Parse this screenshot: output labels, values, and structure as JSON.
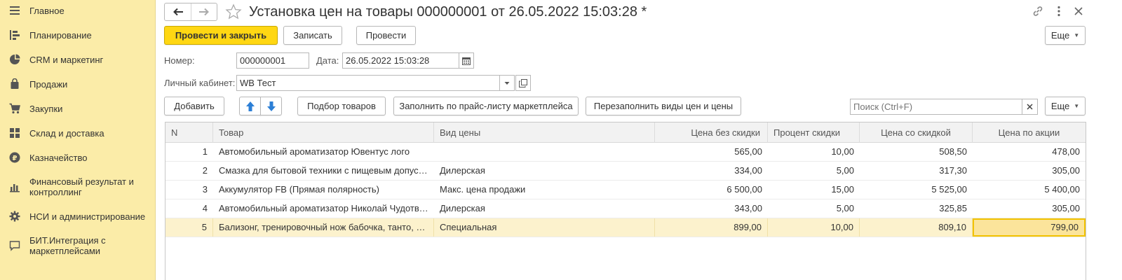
{
  "sidebar": {
    "items": [
      {
        "label": "Главное",
        "icon": "menu-icon"
      },
      {
        "label": "Планирование",
        "icon": "planning-icon"
      },
      {
        "label": "CRM и маркетинг",
        "icon": "pie-chart-icon"
      },
      {
        "label": "Продажи",
        "icon": "shopping-bag-icon"
      },
      {
        "label": "Закупки",
        "icon": "cart-icon"
      },
      {
        "label": "Склад и доставка",
        "icon": "grid-icon"
      },
      {
        "label": "Казначейство",
        "icon": "ruble-icon"
      },
      {
        "label": "Финансовый результат и контроллинг",
        "icon": "bar-chart-icon"
      },
      {
        "label": "НСИ и администрирование",
        "icon": "gear-icon"
      },
      {
        "label": "БИТ.Интеграция с маркетплейсами",
        "icon": "chat-icon"
      }
    ]
  },
  "header": {
    "title": "Установка цен на товары 000000001 от 26.05.2022 15:03:28 *"
  },
  "toolbar": {
    "post_close": "Провести и закрыть",
    "save": "Записать",
    "post": "Провести",
    "more": "Еще"
  },
  "form": {
    "number_label": "Номер:",
    "number_value": "000000001",
    "date_label": "Дата:",
    "date_value": "26.05.2022 15:03:28",
    "cabinet_label": "Личный кабинет:",
    "cabinet_value": "WB Тест"
  },
  "table_toolbar": {
    "add": "Добавить",
    "select_goods": "Подбор товаров",
    "fill_by_price": "Заполнить по прайс-листу маркетплейса",
    "refill": "Перезаполнить виды цен и цены",
    "search_placeholder": "Поиск (Ctrl+F)",
    "more": "Еще"
  },
  "table": {
    "columns": [
      "N",
      "Товар",
      "Вид цены",
      "Цена без скидки",
      "Процент скидки",
      "Цена со скидкой",
      "Цена по акции"
    ],
    "rows": [
      [
        "1",
        "Автомобильный ароматизатор Ювентус лого",
        "",
        "565,00",
        "10,00",
        "508,50",
        "478,00"
      ],
      [
        "2",
        "Смазка для бытовой техники с пищевым допуском",
        "Дилерская",
        "334,00",
        "5,00",
        "317,30",
        "305,00"
      ],
      [
        "3",
        "Аккумулятор FB (Прямая полярность)",
        "Макс. цена продажи",
        "6 500,00",
        "15,00",
        "5 525,00",
        "5 400,00"
      ],
      [
        "4",
        "Автомобильный ароматизатор Николай Чудотворец",
        "Дилерская",
        "343,00",
        "5,00",
        "325,85",
        "305,00"
      ],
      [
        "5",
        "Бализонг, тренировочный нож бабочка, танто, тупой",
        "Специальная",
        "899,00",
        "10,00",
        "809,10",
        "799,00"
      ]
    ]
  },
  "colors": {
    "sidebar_bg": "#fbeca8",
    "primary_button": "#ffd713",
    "selected_row": "#fcf2cd",
    "active_cell_border": "#f2c200",
    "arrow_blue": "#2c7fd6"
  }
}
